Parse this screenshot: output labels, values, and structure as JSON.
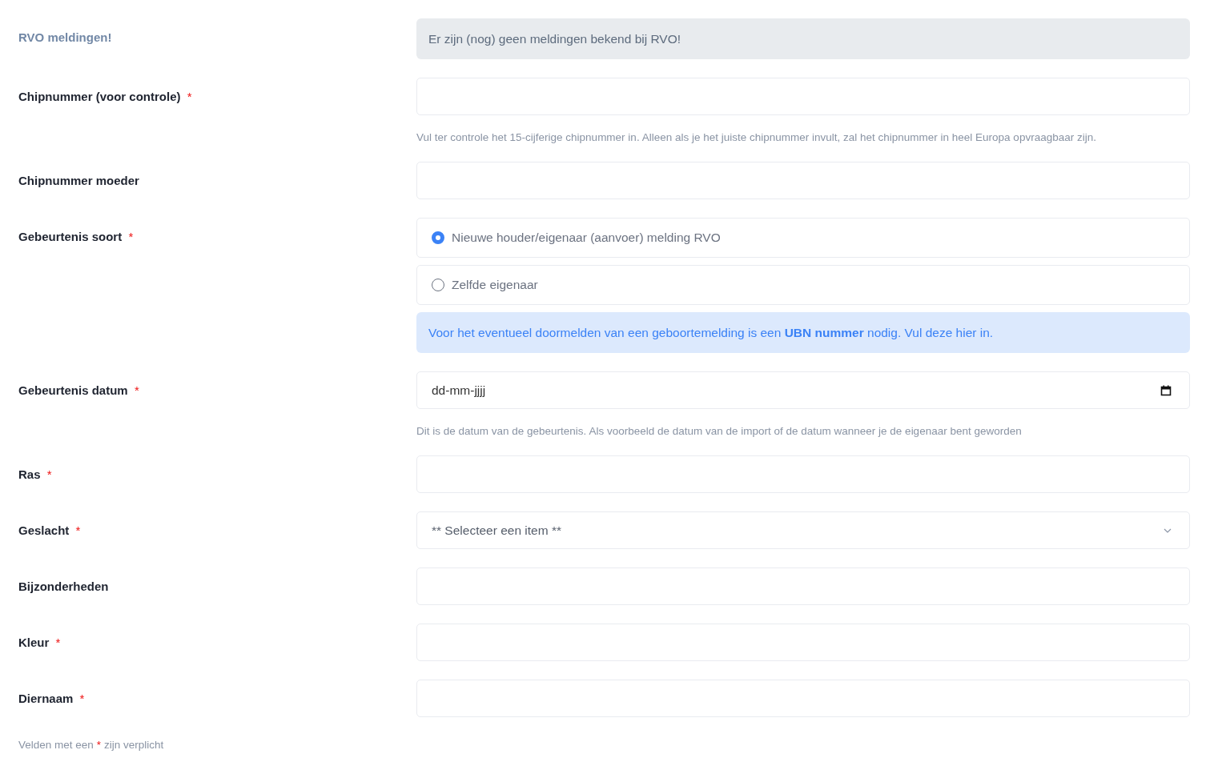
{
  "fields": [
    {
      "kind": "alert",
      "label": "RVO meldingen!",
      "value": "Er zijn (nog) geen meldingen bekend bij RVO!"
    },
    {
      "kind": "text",
      "label": "Chipnummer (voor controle)",
      "required_mark": "*",
      "help": "Vul ter controle het 15-cijferige chipnummer in. Alleen als je het juiste chipnummer invult, zal het chipnummer in heel Europa opvraagbaar zijn."
    },
    {
      "kind": "text",
      "label": "Chipnummer moeder"
    },
    {
      "kind": "radio",
      "label": "Gebeurtenis soort",
      "required_mark": "*",
      "options": [
        {
          "label": "Nieuwe houder/eigenaar (aanvoer) melding RVO",
          "selected": true
        },
        {
          "label": "Zelfde eigenaar",
          "selected": false
        }
      ],
      "info": "Voor het eventueel doormelden van een geboortemelding is een **UBN nummer** nodig. Vul deze hier in."
    },
    {
      "kind": "date",
      "label": "Gebeurtenis datum",
      "required_mark": "*",
      "placeholder": "dd-mm-jjjj",
      "help": "Dit is de datum van de gebeurtenis. Als voorbeeld de datum van de import of de datum wanneer je de eigenaar bent geworden"
    },
    {
      "kind": "text",
      "label": "Ras",
      "required_mark": "*"
    },
    {
      "kind": "select",
      "label": "Geslacht",
      "required_mark": "*",
      "value": "** Selecteer een item **"
    },
    {
      "kind": "text",
      "label": "Bijzonderheden"
    },
    {
      "kind": "text",
      "label": "Kleur",
      "required_mark": "*"
    },
    {
      "kind": "text",
      "label": "Diernaam",
      "required_mark": "*"
    }
  ],
  "footer": {
    "before": "Velden met een",
    "mark": "*",
    "after": "zijn verplicht"
  }
}
